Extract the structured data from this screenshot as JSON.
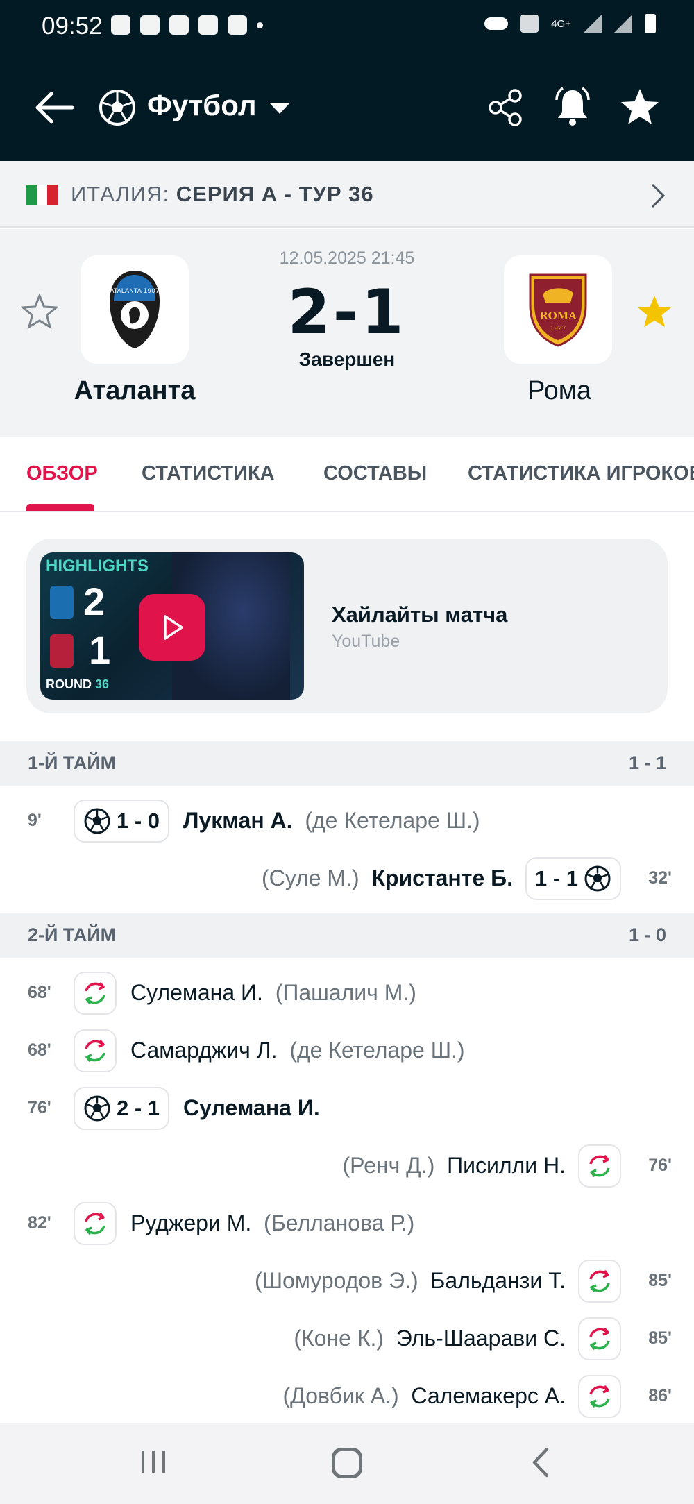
{
  "status_bar": {
    "time": "09:52",
    "network": "4G+"
  },
  "header": {
    "sport": "Футбол"
  },
  "league": {
    "country": "ИТАЛИЯ:",
    "competition": "СЕРИЯ А - ТУР 36"
  },
  "match": {
    "datetime": "12.05.2025 21:45",
    "score": "2-1",
    "status": "Завершен",
    "home": {
      "name": "Аталанта",
      "favorite": false
    },
    "away": {
      "name": "Рома",
      "favorite": true
    }
  },
  "tabs": [
    {
      "label": "ОБЗОР",
      "active": true
    },
    {
      "label": "СТАТИСТИКА",
      "active": false
    },
    {
      "label": "СОСТАВЫ",
      "active": false
    },
    {
      "label": "СТАТИСТИКА ИГРОКОВ",
      "active": false
    }
  ],
  "highlights": {
    "title": "Хайлайты матча",
    "source": "YouTube",
    "thumb_label": "HIGHLIGHTS",
    "thumb_home_score": "2",
    "thumb_away_score": "1",
    "thumb_round_label": "ROUND",
    "thumb_round_number": "36",
    "logo_home_text": "ATALANTA 1907",
    "logo_away_text": "ROMA 1927"
  },
  "periods": [
    {
      "name": "1-Й ТАЙМ",
      "score": "1 - 1",
      "events": [
        {
          "minute": "9'",
          "side": "home",
          "type": "goal",
          "score": "1 - 0",
          "player": "Лукман А.",
          "assist": "(де Кетеларе Ш.)"
        },
        {
          "minute": "32'",
          "side": "away",
          "type": "goal",
          "score": "1 - 1",
          "player": "Кристанте Б.",
          "assist": "(Суле М.)"
        }
      ]
    },
    {
      "name": "2-Й ТАЙМ",
      "score": "1 - 0",
      "events": [
        {
          "minute": "68'",
          "side": "home",
          "type": "sub",
          "player": "Сулемана И.",
          "assist": "(Пашалич М.)"
        },
        {
          "minute": "68'",
          "side": "home",
          "type": "sub",
          "player": "Самарджич Л.",
          "assist": "(де Кетеларе Ш.)"
        },
        {
          "minute": "76'",
          "side": "home",
          "type": "goal",
          "score": "2 - 1",
          "player": "Сулемана И.",
          "assist": ""
        },
        {
          "minute": "76'",
          "side": "away",
          "type": "sub",
          "player": "Писилли Н.",
          "assist": "(Ренч Д.)"
        },
        {
          "minute": "82'",
          "side": "home",
          "type": "sub",
          "player": "Руджери М.",
          "assist": "(Белланова Р.)"
        },
        {
          "minute": "85'",
          "side": "away",
          "type": "sub",
          "player": "Бальданзи Т.",
          "assist": "(Шомуродов Э.)"
        },
        {
          "minute": "85'",
          "side": "away",
          "type": "sub",
          "player": "Эль-Шаарави С.",
          "assist": "(Коне К.)"
        },
        {
          "minute": "86'",
          "side": "away",
          "type": "sub",
          "player": "Салемакерс А.",
          "assist": "(Довбик А.)"
        }
      ]
    }
  ],
  "colors": {
    "header_bg": "#011a24",
    "accent": "#e0134b",
    "favorite_star": "#f5c400",
    "sub_in": "#2bb24c",
    "sub_out": "#e0134b"
  }
}
